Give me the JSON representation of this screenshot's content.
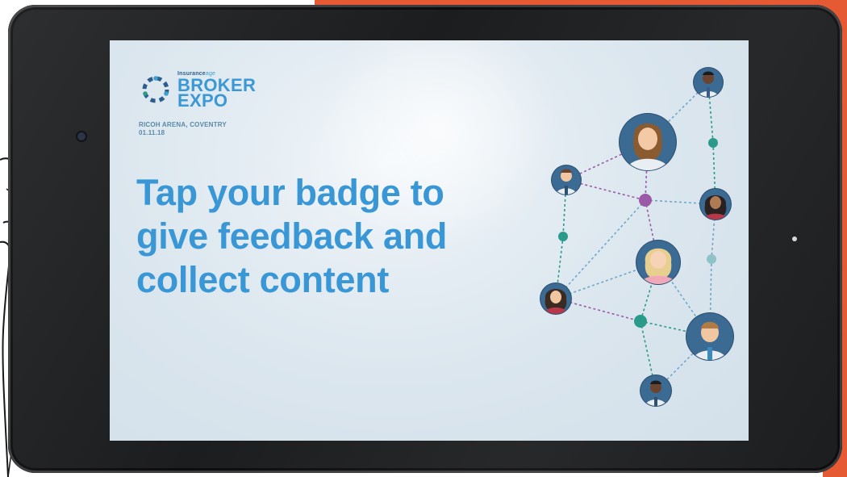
{
  "logo": {
    "brand_prefix": "Insurance",
    "brand_suffix": "age",
    "line1": "BROKER",
    "line2": "EXPO"
  },
  "venue": {
    "location": "RICOH ARENA, COVENTRY",
    "date": "01.11.18"
  },
  "headline": {
    "line1": "Tap your badge to",
    "line2": "give feedback and",
    "line3": "collect content"
  },
  "colors": {
    "accent_blue": "#3a97d6",
    "accent_teal": "#2a9a8a",
    "accent_purple": "#9a5aa8",
    "background_orange": "#e65a33",
    "tablet_bezel": "#1c1d1f"
  }
}
